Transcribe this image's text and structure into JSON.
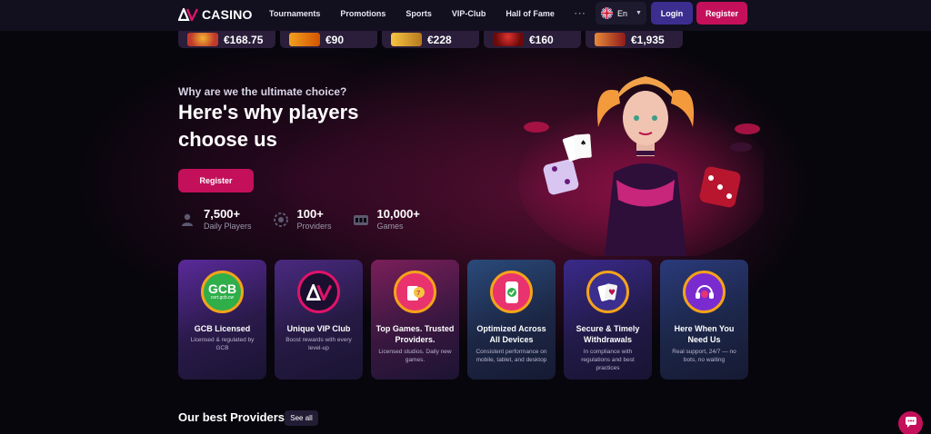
{
  "header": {
    "logo_text": "CASINO",
    "nav": [
      "Tournaments",
      "Promotions",
      "Sports",
      "VIP-Club",
      "Hall of Fame"
    ],
    "nav_more": "···",
    "language": "En",
    "login_label": "Login",
    "register_label": "Register"
  },
  "winners": [
    {
      "amount": "€168.75",
      "color": "#c0392b"
    },
    {
      "amount": "€90",
      "color": "#d35400"
    },
    {
      "amount": "€228",
      "color": "#b7791f"
    },
    {
      "amount": "€160",
      "color": "#a31212"
    },
    {
      "amount": "€1,935",
      "color": "#c0392b"
    }
  ],
  "hero": {
    "kicker": "Why are we the ultimate choice?",
    "title": "Here's why players choose us",
    "cta_label": "Register",
    "stats": [
      {
        "value": "7,500+",
        "label": "Daily Players",
        "icon": "user-icon"
      },
      {
        "value": "100+",
        "label": "Providers",
        "icon": "chip-icon"
      },
      {
        "value": "10,000+",
        "label": "Games",
        "icon": "slot-icon"
      }
    ]
  },
  "features": [
    {
      "title": "GCB Licensed",
      "desc": "Licensed & regulated by GCB",
      "badge_text": "GCB",
      "badge_sub": "cert.gcb.cw",
      "icon": "license-icon",
      "bg": "#2a1a4a"
    },
    {
      "title": "Unique VIP Club",
      "desc": "Boost rewards with every level-up",
      "badge_text": "AV",
      "badge_sub": "",
      "icon": "vip-icon",
      "bg": "#261a44"
    },
    {
      "title": "Top Games. Trusted Providers.",
      "desc": "Licensed studios. Daily new games.",
      "badge_text": "",
      "badge_sub": "",
      "icon": "games-icon",
      "bg": "#3a1740"
    },
    {
      "title": "Optimized Across All Devices",
      "desc": "Consistent performance on mobile, tablet, and desktop",
      "badge_text": "",
      "badge_sub": "",
      "icon": "device-icon",
      "bg": "#1c2745"
    },
    {
      "title": "Secure & Timely Withdrawals",
      "desc": "In compliance with regulations and best practices",
      "badge_text": "",
      "badge_sub": "",
      "icon": "cards-icon",
      "bg": "#221a48"
    },
    {
      "title": "Here When You Need Us",
      "desc": "Real support, 24/7 — no bots, no waiting",
      "badge_text": "",
      "badge_sub": "",
      "icon": "support-icon",
      "bg": "#1c2648"
    }
  ],
  "providers": {
    "title": "Our best Providers",
    "see_all_label": "See all"
  }
}
